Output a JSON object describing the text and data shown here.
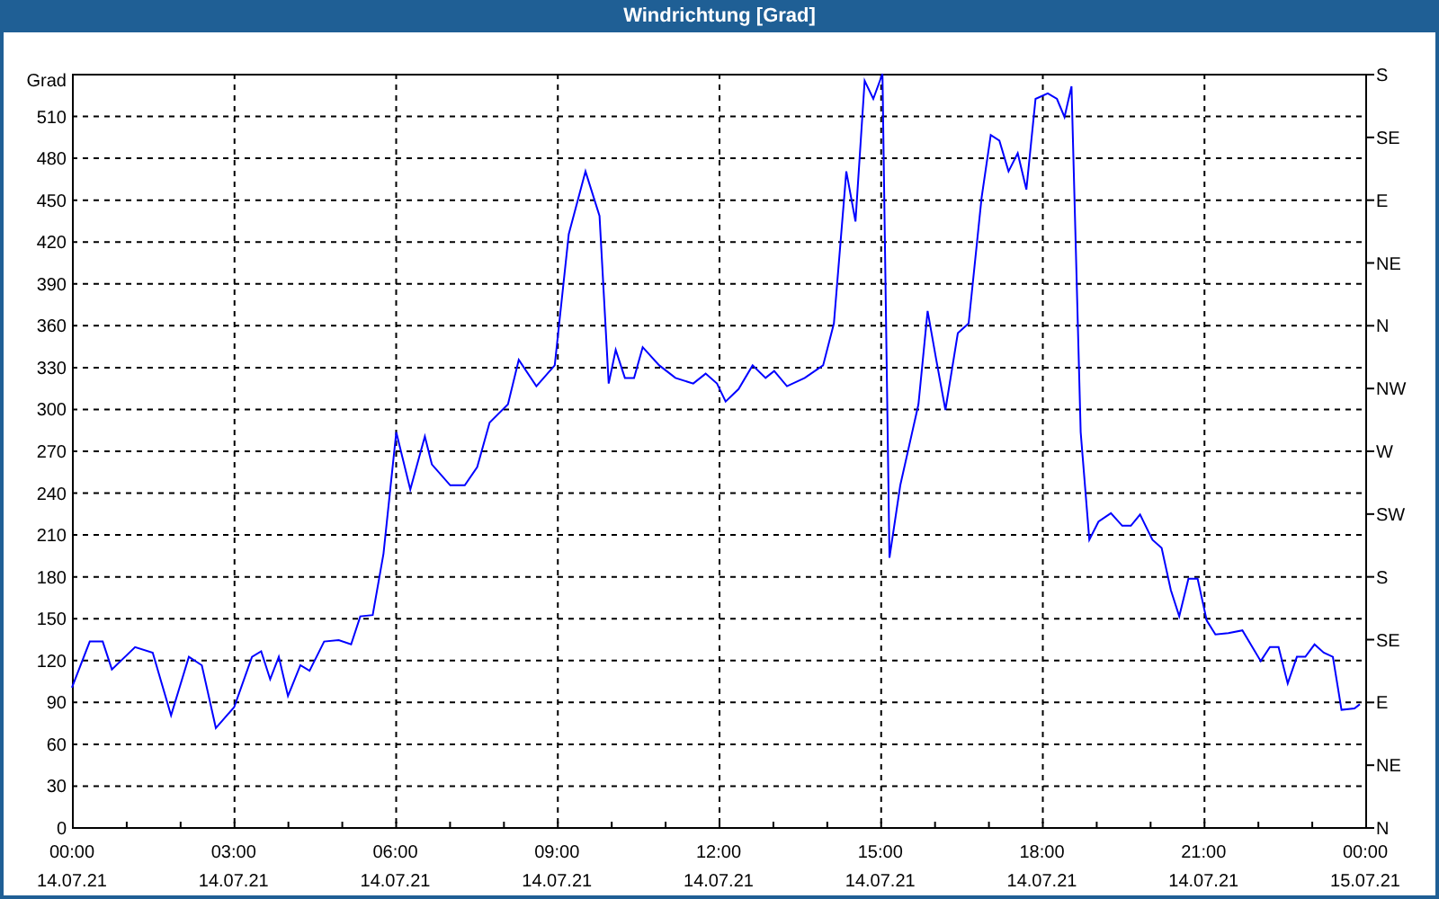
{
  "window": {
    "title": "Windrichtung [Grad]"
  },
  "chart": {
    "chart_data": {
      "type": "line",
      "ylabel": "Grad",
      "xlim": [
        0,
        24
      ],
      "ylim": [
        0,
        540
      ],
      "grid": true,
      "yticks": [
        0,
        30,
        60,
        90,
        120,
        150,
        180,
        210,
        240,
        270,
        300,
        330,
        360,
        390,
        420,
        450,
        480,
        510
      ],
      "xticks": [
        {
          "value": 0,
          "label": "00:00"
        },
        {
          "value": 3,
          "label": "03:00"
        },
        {
          "value": 6,
          "label": "06:00"
        },
        {
          "value": 9,
          "label": "09:00"
        },
        {
          "value": 12,
          "label": "12:00"
        },
        {
          "value": 15,
          "label": "15:00"
        },
        {
          "value": 18,
          "label": "18:00"
        },
        {
          "value": 21,
          "label": "21:00"
        },
        {
          "value": 24,
          "label": "00:00"
        }
      ],
      "x": [
        0,
        0.33,
        0.57,
        0.74,
        1.17,
        1.5,
        1.84,
        2.17,
        2.41,
        2.67,
        3.01,
        3.34,
        3.51,
        3.68,
        3.84,
        4.01,
        4.24,
        4.41,
        4.68,
        4.95,
        5.18,
        5.35,
        5.58,
        5.78,
        6.02,
        6.28,
        6.55,
        6.68,
        7.02,
        7.29,
        7.52,
        7.75,
        8.09,
        8.29,
        8.62,
        8.96,
        9.22,
        9.53,
        9.79,
        9.96,
        10.09,
        10.26,
        10.43,
        10.59,
        10.9,
        11.2,
        11.53,
        11.76,
        11.97,
        12.13,
        12.37,
        12.63,
        12.87,
        13.03,
        13.27,
        13.6,
        13.94,
        14.14,
        14.37,
        14.54,
        14.71,
        14.87,
        15.04,
        15.17,
        15.37,
        15.71,
        15.88,
        16.04,
        16.21,
        16.44,
        16.64,
        16.88,
        17.05,
        17.21,
        17.38,
        17.55,
        17.71,
        17.88,
        18.11,
        18.28,
        18.42,
        18.55,
        18.72,
        18.88,
        19.05,
        19.28,
        19.49,
        19.65,
        19.82,
        20.05,
        20.22,
        20.39,
        20.55,
        20.72,
        20.89,
        21.06,
        21.22,
        21.46,
        21.72,
        22.06,
        22.23,
        22.39,
        22.56,
        22.73,
        22.89,
        23.06,
        23.23,
        23.4,
        23.56,
        23.8,
        23.9
      ],
      "series": [
        {
          "color": "#0000ff",
          "values": [
            100,
            133,
            133,
            113,
            129,
            125,
            80,
            122,
            116,
            71,
            86,
            122,
            126,
            106,
            122,
            94,
            116,
            112,
            133,
            134,
            131,
            151,
            152,
            196,
            283,
            242,
            280,
            260,
            245,
            245,
            258,
            290,
            303,
            335,
            316,
            331,
            425,
            470,
            438,
            318,
            342,
            322,
            322,
            344,
            331,
            322,
            318,
            325,
            318,
            305,
            314,
            331,
            322,
            327,
            316,
            322,
            331,
            361,
            470,
            434,
            535,
            522,
            540,
            193,
            245,
            303,
            370,
            335,
            299,
            354,
            361,
            451,
            496,
            492,
            470,
            483,
            457,
            522,
            526,
            522,
            509,
            531,
            283,
            206,
            219,
            225,
            216,
            216,
            224,
            206,
            200,
            170,
            151,
            178,
            178,
            148,
            138,
            139,
            141,
            119,
            129,
            129,
            103,
            122,
            122,
            131,
            125,
            122,
            84,
            85,
            88
          ]
        }
      ]
    },
    "x_tick_dates": [
      "14.07.21",
      "14.07.21",
      "14.07.21",
      "14.07.21",
      "14.07.21",
      "14.07.21",
      "14.07.21",
      "14.07.21",
      "15.07.21"
    ],
    "right_axis_labels": [
      "S",
      "SE",
      "E",
      "NE",
      "N",
      "NW",
      "W",
      "SW",
      "S",
      "SE",
      "E",
      "NE",
      "N"
    ]
  }
}
